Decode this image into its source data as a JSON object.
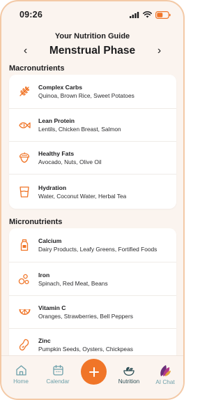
{
  "status": {
    "time": "09:26"
  },
  "header": {
    "title": "Your Nutrition Guide",
    "phase": "Menstrual Phase",
    "prev_arrow": "‹",
    "next_arrow": "›"
  },
  "macronutrients": {
    "title": "Macronutrients",
    "items": [
      {
        "name": "Complex Carbs",
        "foods": "Quinoa, Brown Rice, Sweet Potatoes",
        "icon": "wheat-icon"
      },
      {
        "name": "Lean Protein",
        "foods": "Lentils, Chicken Breast, Salmon",
        "icon": "fish-icon"
      },
      {
        "name": "Healthy Fats",
        "foods": "Avocado, Nuts, Olive Oil",
        "icon": "acorn-icon"
      },
      {
        "name": "Hydration",
        "foods": "Water, Coconut Water, Herbal Tea",
        "icon": "glass-icon"
      }
    ]
  },
  "micronutrients": {
    "title": "Micronutrients",
    "items": [
      {
        "name": "Calcium",
        "foods": "Dairy Products, Leafy Greens, Fortified Foods",
        "icon": "milk-icon"
      },
      {
        "name": "Iron",
        "foods": "Spinach, Red Meat, Beans",
        "icon": "bubbles-icon"
      },
      {
        "name": "Vitamin C",
        "foods": "Oranges, Strawberries, Bell Peppers",
        "icon": "citrus-icon"
      },
      {
        "name": "Zinc",
        "foods": "Pumpkin Seeds, Oysters, Chickpeas",
        "icon": "bean-icon"
      }
    ]
  },
  "tabs": [
    {
      "label": "Home",
      "icon": "home-icon",
      "active": false
    },
    {
      "label": "Calendar",
      "icon": "calendar-icon",
      "active": false
    },
    {
      "label": "",
      "icon": "plus-icon",
      "active": false
    },
    {
      "label": "Nutrition",
      "icon": "bowl-icon",
      "active": true
    },
    {
      "label": "AI Chat",
      "icon": "ai-chat-icon",
      "active": false
    }
  ],
  "colors": {
    "accent": "#f07528",
    "background": "#fbf4ef",
    "tab_inactive": "#6b9fa9",
    "tab_active": "#2e4f56"
  }
}
